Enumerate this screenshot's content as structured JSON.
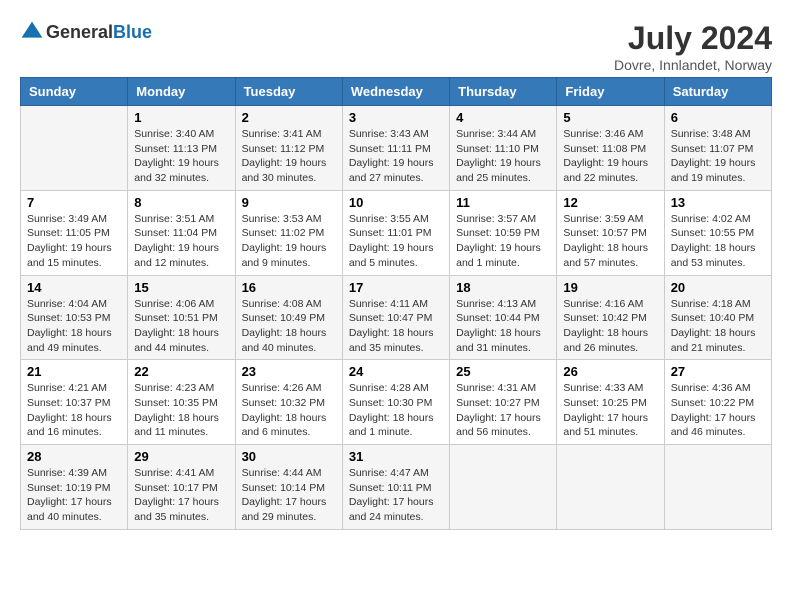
{
  "header": {
    "logo": {
      "text_general": "General",
      "text_blue": "Blue"
    },
    "title": "July 2024",
    "location": "Dovre, Innlandet, Norway"
  },
  "calendar": {
    "days_of_week": [
      "Sunday",
      "Monday",
      "Tuesday",
      "Wednesday",
      "Thursday",
      "Friday",
      "Saturday"
    ],
    "weeks": [
      [
        {
          "day": "",
          "info": ""
        },
        {
          "day": "1",
          "info": "Sunrise: 3:40 AM\nSunset: 11:13 PM\nDaylight: 19 hours and 32 minutes."
        },
        {
          "day": "2",
          "info": "Sunrise: 3:41 AM\nSunset: 11:12 PM\nDaylight: 19 hours and 30 minutes."
        },
        {
          "day": "3",
          "info": "Sunrise: 3:43 AM\nSunset: 11:11 PM\nDaylight: 19 hours and 27 minutes."
        },
        {
          "day": "4",
          "info": "Sunrise: 3:44 AM\nSunset: 11:10 PM\nDaylight: 19 hours and 25 minutes."
        },
        {
          "day": "5",
          "info": "Sunrise: 3:46 AM\nSunset: 11:08 PM\nDaylight: 19 hours and 22 minutes."
        },
        {
          "day": "6",
          "info": "Sunrise: 3:48 AM\nSunset: 11:07 PM\nDaylight: 19 hours and 19 minutes."
        }
      ],
      [
        {
          "day": "7",
          "info": "Sunrise: 3:49 AM\nSunset: 11:05 PM\nDaylight: 19 hours and 15 minutes."
        },
        {
          "day": "8",
          "info": "Sunrise: 3:51 AM\nSunset: 11:04 PM\nDaylight: 19 hours and 12 minutes."
        },
        {
          "day": "9",
          "info": "Sunrise: 3:53 AM\nSunset: 11:02 PM\nDaylight: 19 hours and 9 minutes."
        },
        {
          "day": "10",
          "info": "Sunrise: 3:55 AM\nSunset: 11:01 PM\nDaylight: 19 hours and 5 minutes."
        },
        {
          "day": "11",
          "info": "Sunrise: 3:57 AM\nSunset: 10:59 PM\nDaylight: 19 hours and 1 minute."
        },
        {
          "day": "12",
          "info": "Sunrise: 3:59 AM\nSunset: 10:57 PM\nDaylight: 18 hours and 57 minutes."
        },
        {
          "day": "13",
          "info": "Sunrise: 4:02 AM\nSunset: 10:55 PM\nDaylight: 18 hours and 53 minutes."
        }
      ],
      [
        {
          "day": "14",
          "info": "Sunrise: 4:04 AM\nSunset: 10:53 PM\nDaylight: 18 hours and 49 minutes."
        },
        {
          "day": "15",
          "info": "Sunrise: 4:06 AM\nSunset: 10:51 PM\nDaylight: 18 hours and 44 minutes."
        },
        {
          "day": "16",
          "info": "Sunrise: 4:08 AM\nSunset: 10:49 PM\nDaylight: 18 hours and 40 minutes."
        },
        {
          "day": "17",
          "info": "Sunrise: 4:11 AM\nSunset: 10:47 PM\nDaylight: 18 hours and 35 minutes."
        },
        {
          "day": "18",
          "info": "Sunrise: 4:13 AM\nSunset: 10:44 PM\nDaylight: 18 hours and 31 minutes."
        },
        {
          "day": "19",
          "info": "Sunrise: 4:16 AM\nSunset: 10:42 PM\nDaylight: 18 hours and 26 minutes."
        },
        {
          "day": "20",
          "info": "Sunrise: 4:18 AM\nSunset: 10:40 PM\nDaylight: 18 hours and 21 minutes."
        }
      ],
      [
        {
          "day": "21",
          "info": "Sunrise: 4:21 AM\nSunset: 10:37 PM\nDaylight: 18 hours and 16 minutes."
        },
        {
          "day": "22",
          "info": "Sunrise: 4:23 AM\nSunset: 10:35 PM\nDaylight: 18 hours and 11 minutes."
        },
        {
          "day": "23",
          "info": "Sunrise: 4:26 AM\nSunset: 10:32 PM\nDaylight: 18 hours and 6 minutes."
        },
        {
          "day": "24",
          "info": "Sunrise: 4:28 AM\nSunset: 10:30 PM\nDaylight: 18 hours and 1 minute."
        },
        {
          "day": "25",
          "info": "Sunrise: 4:31 AM\nSunset: 10:27 PM\nDaylight: 17 hours and 56 minutes."
        },
        {
          "day": "26",
          "info": "Sunrise: 4:33 AM\nSunset: 10:25 PM\nDaylight: 17 hours and 51 minutes."
        },
        {
          "day": "27",
          "info": "Sunrise: 4:36 AM\nSunset: 10:22 PM\nDaylight: 17 hours and 46 minutes."
        }
      ],
      [
        {
          "day": "28",
          "info": "Sunrise: 4:39 AM\nSunset: 10:19 PM\nDaylight: 17 hours and 40 minutes."
        },
        {
          "day": "29",
          "info": "Sunrise: 4:41 AM\nSunset: 10:17 PM\nDaylight: 17 hours and 35 minutes."
        },
        {
          "day": "30",
          "info": "Sunrise: 4:44 AM\nSunset: 10:14 PM\nDaylight: 17 hours and 29 minutes."
        },
        {
          "day": "31",
          "info": "Sunrise: 4:47 AM\nSunset: 10:11 PM\nDaylight: 17 hours and 24 minutes."
        },
        {
          "day": "",
          "info": ""
        },
        {
          "day": "",
          "info": ""
        },
        {
          "day": "",
          "info": ""
        }
      ]
    ]
  }
}
